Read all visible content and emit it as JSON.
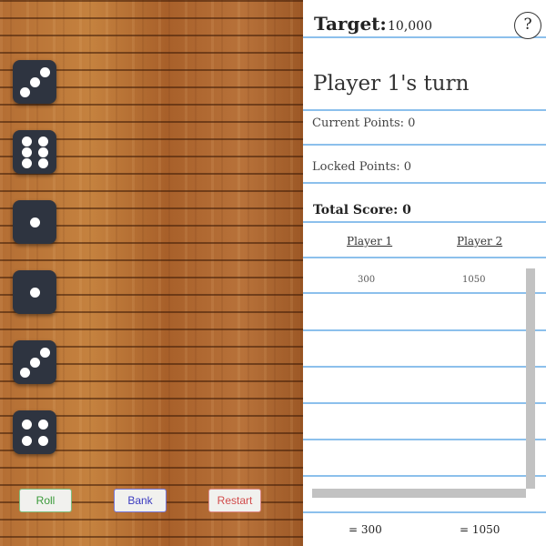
{
  "dice": [
    3,
    6,
    1,
    1,
    3,
    4
  ],
  "controls": {
    "roll_label": "Roll",
    "bank_label": "Bank",
    "restart_label": "Restart"
  },
  "scorecard": {
    "target_label": "Target:",
    "target_value": "10,000",
    "help_label": "?",
    "turn_text": "Player 1's turn",
    "current_points": "Current Points: 0",
    "locked_points": "Locked Points: 0",
    "total_score": "Total Score: 0",
    "players": [
      "Player 1",
      "Player 2"
    ],
    "rows": [
      [
        "300",
        "1050"
      ]
    ],
    "totals": [
      "= 300",
      "= 1050"
    ]
  },
  "colors": {
    "roll_text": "#3a9a3a",
    "bank_text": "#3b3bc0",
    "restart_text": "#d24b4b",
    "paper_rule": "#8cc0ec",
    "die_face": "#2e3440"
  }
}
